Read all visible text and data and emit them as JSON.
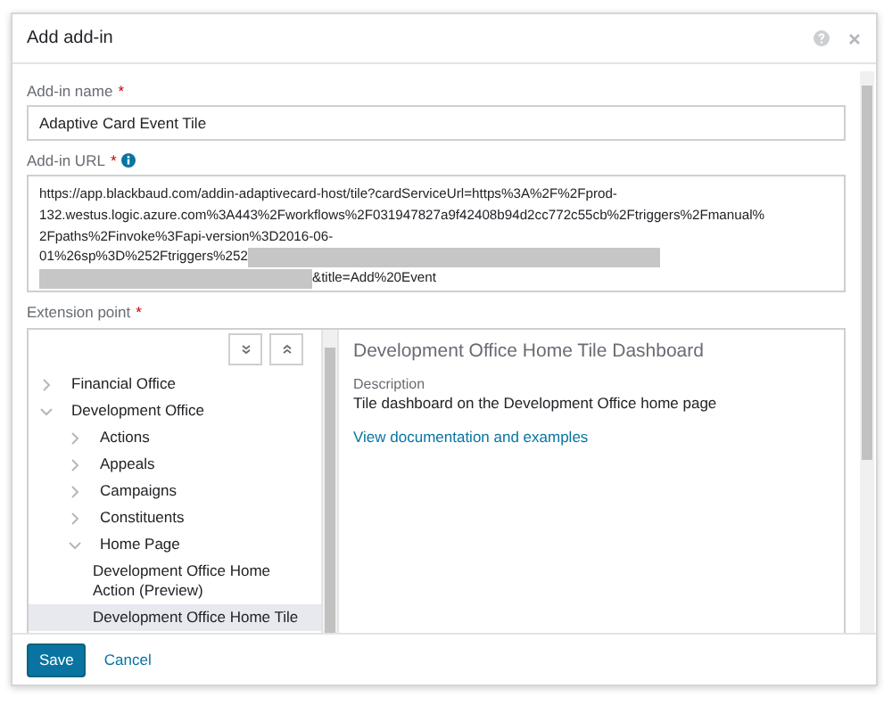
{
  "dialog": {
    "title": "Add add-in"
  },
  "fields": [
    {
      "kind": "input",
      "label": "Add-in name",
      "required_marker": "*",
      "info": false,
      "value": "Adaptive Card Event Tile"
    },
    {
      "kind": "textarea",
      "label": "Add-in URL",
      "required_marker": "*",
      "info": true,
      "lines": [
        [
          {
            "kind": "text",
            "text": "https://app.blackbaud.com/addin-adaptivecard-host/tile?cardServiceUrl=https%3A%2F%2Fprod-"
          }
        ],
        [
          {
            "kind": "text",
            "text": "132.westus.logic.azure.com%3A443%2Fworkflows%2F031947827a9f42408b94d2cc772c55cb%2Ftriggers%2Fmanual%"
          }
        ],
        [
          {
            "kind": "text",
            "text": "2Fpaths%2Finvoke%3Fapi-version%3D2016-06-"
          }
        ],
        [
          {
            "kind": "text",
            "text": "01%26sp%3D%252Ftriggers%252"
          },
          {
            "kind": "redacted"
          }
        ],
        [
          {
            "kind": "redacted"
          },
          {
            "kind": "text",
            "text": "&title=Add%20Event"
          }
        ]
      ]
    }
  ],
  "extension_point": {
    "label": "Extension point",
    "required_marker": "*",
    "tree": [
      {
        "label": "Financial Office",
        "expanded": false,
        "selected": false
      },
      {
        "label": "Development Office",
        "expanded": true,
        "selected": false,
        "children": [
          {
            "label": "Actions",
            "expanded": false,
            "selected": false
          },
          {
            "label": "Appeals",
            "expanded": false,
            "selected": false
          },
          {
            "label": "Campaigns",
            "expanded": false,
            "selected": false
          },
          {
            "label": "Constituents",
            "expanded": false,
            "selected": false
          },
          {
            "label": "Home Page",
            "expanded": true,
            "selected": false,
            "children": [
              {
                "label": "Development Office Home Action (Preview)",
                "kind": "leaf",
                "selected": false
              },
              {
                "label": "Development Office Home Tile",
                "kind": "leaf",
                "selected": true
              }
            ]
          }
        ]
      }
    ],
    "detail": {
      "title": "Development Office Home Tile Dashboard",
      "description_label": "Description",
      "description": "Tile dashboard on the Development Office home page",
      "link": "View documentation and examples"
    }
  },
  "buttons": [
    {
      "label": "Save",
      "kind": "primary"
    },
    {
      "label": "Cancel",
      "kind": "link"
    }
  ]
}
